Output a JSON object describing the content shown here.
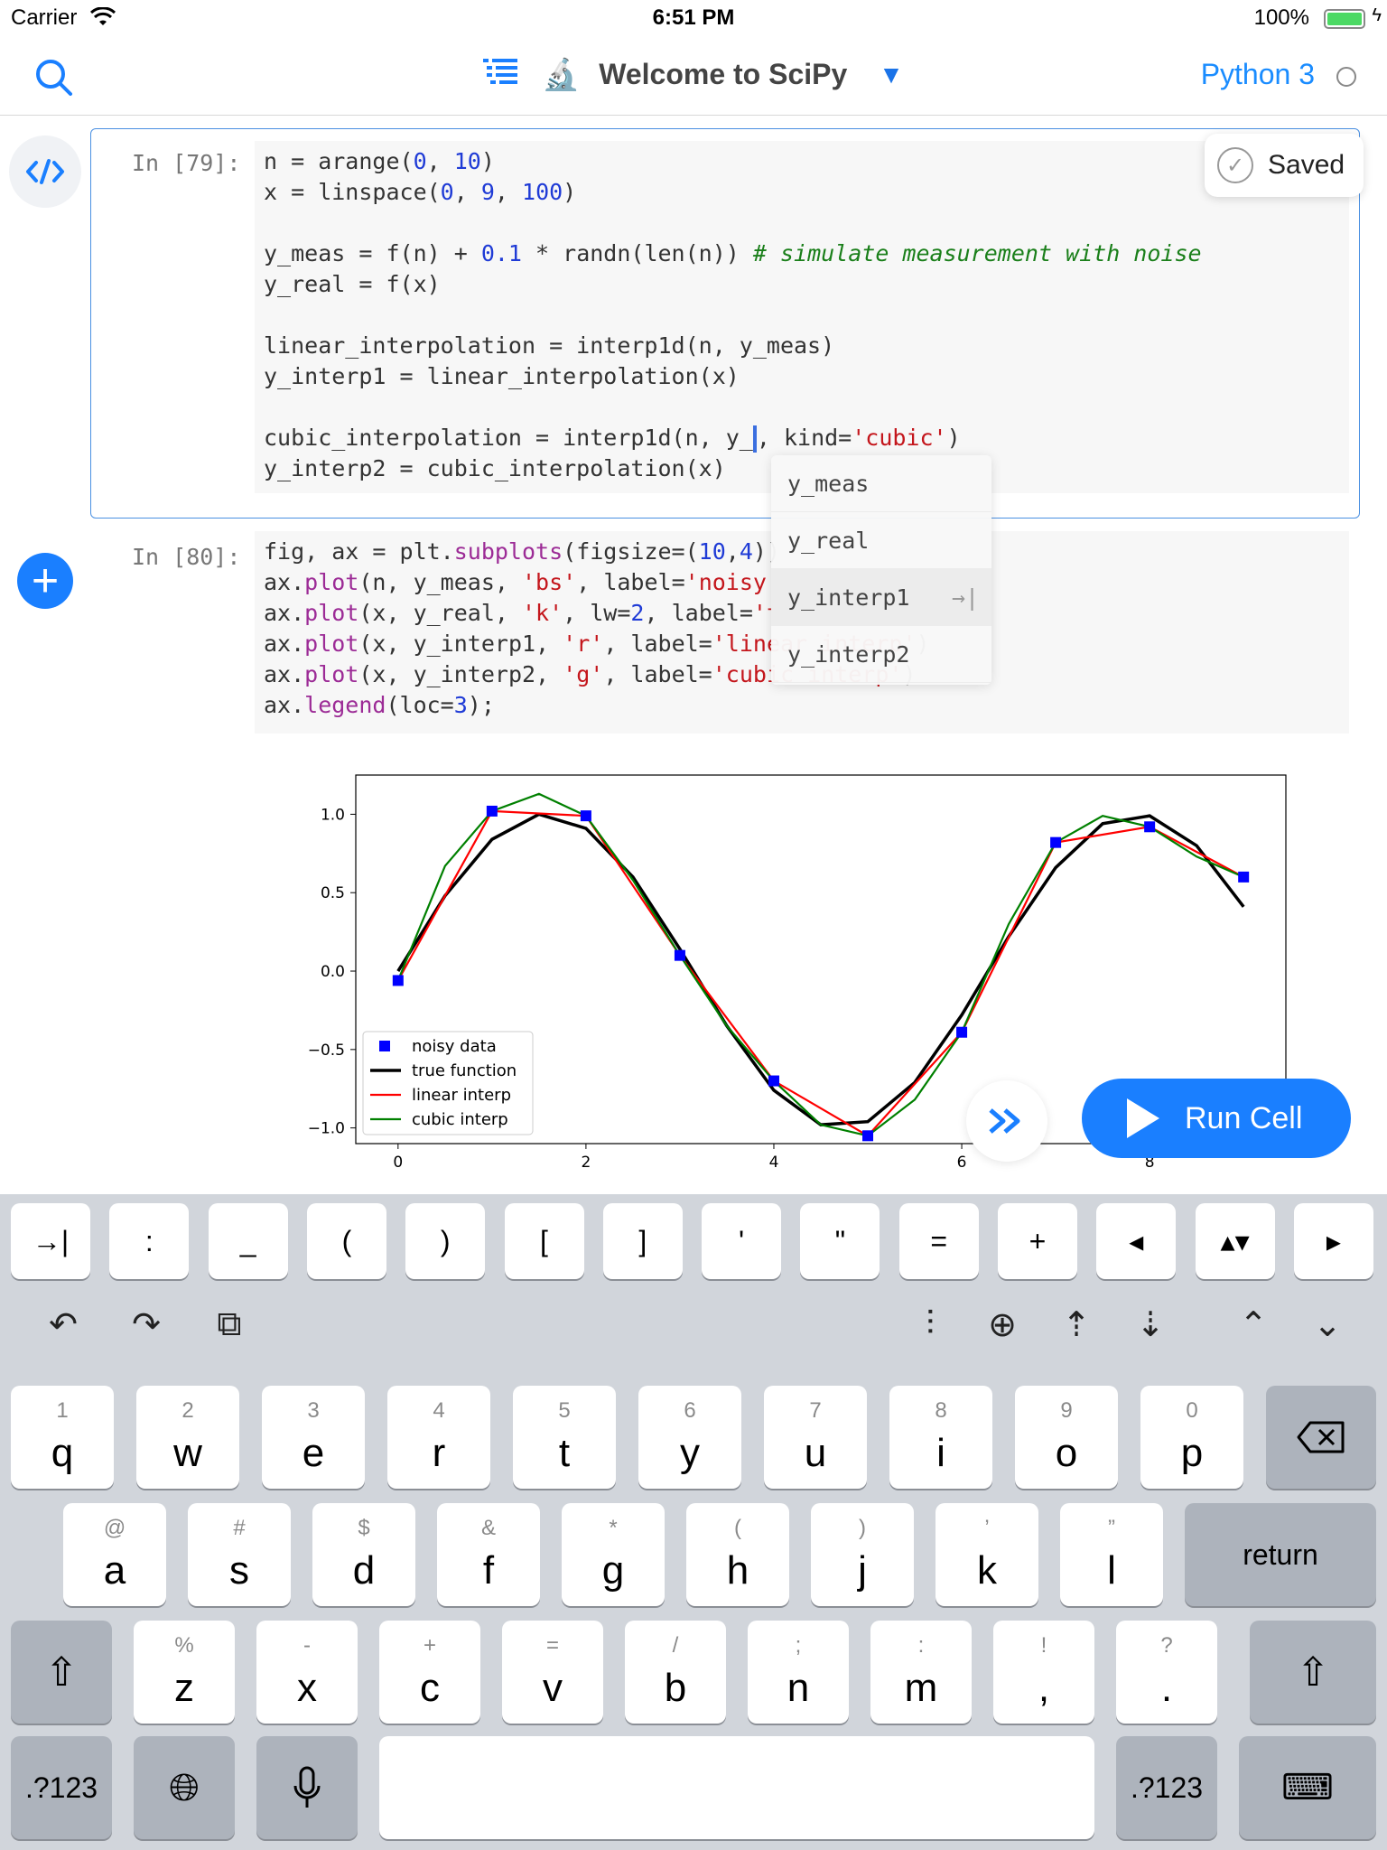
{
  "status_bar": {
    "carrier": "Carrier",
    "time": "6:51 PM",
    "battery": "100%"
  },
  "navbar": {
    "title": "Welcome to SciPy",
    "kernel": "Python 3",
    "icons": [
      "search-icon",
      "toc-icon",
      "microscope-icon",
      "dropdown-triangle-icon",
      "kernel-status-icon"
    ]
  },
  "cell1": {
    "prompt": "In [79]:",
    "lines": [
      "n = arange(0, 10)",
      "x = linspace(0, 9, 100)",
      "",
      "y_meas = f(n) + 0.1 * randn(len(n)) # simulate measurement with noise",
      "y_real = f(x)",
      "",
      "linear_interpolation = interp1d(n, y_meas)",
      "y_interp1 = linear_interpolation(x)",
      "",
      "cubic_interpolation = interp1d(n, y_, kind='cubic')",
      "y_interp2 = cubic_interpolation(x)"
    ]
  },
  "saved_badge": "Saved",
  "autocomplete": {
    "items": [
      "y_meas",
      "y_real",
      "y_interp1",
      "y_interp2"
    ],
    "selected_index": 2,
    "tab_hint": "→|"
  },
  "cell2": {
    "prompt": "In [80]:",
    "lines": [
      "fig, ax = plt.subplots(figsize=(10,4))",
      "ax.plot(n, y_meas, 'bs', label='noisy data')",
      "ax.plot(x, y_real, 'k', lw=2, label='true function')",
      "ax.plot(x, y_interp1, 'r', label='linear interp')",
      "ax.plot(x, y_interp2, 'g', label='cubic interp')",
      "ax.legend(loc=3);"
    ]
  },
  "chart_data": {
    "type": "line",
    "title": "",
    "xlabel": "",
    "ylabel": "",
    "xlim": [
      -0.45,
      9.45
    ],
    "ylim": [
      -1.1,
      1.25
    ],
    "xticks": [
      "0",
      "2",
      "4",
      "6",
      "8"
    ],
    "yticks": [
      "1.0",
      "0.5",
      "0.0",
      "−0.5",
      "−1.0"
    ],
    "legend_position": "lower-left",
    "grid": false,
    "series": [
      {
        "name": "noisy data",
        "kind": "scatter",
        "color": "#0000ff",
        "x": [
          0,
          1,
          2,
          3,
          4,
          5,
          6,
          7,
          8,
          9
        ],
        "y": [
          -0.06,
          1.02,
          0.99,
          0.1,
          -0.7,
          -1.05,
          -0.39,
          0.82,
          0.92,
          0.6
        ]
      },
      {
        "name": "true function",
        "kind": "line",
        "color": "#000000",
        "x": [
          0,
          0.5,
          1,
          1.5,
          2,
          2.5,
          3,
          3.5,
          4,
          4.5,
          5,
          5.5,
          6,
          6.5,
          7,
          7.5,
          8,
          8.5,
          9
        ],
        "y": [
          0,
          0.48,
          0.84,
          1.0,
          0.91,
          0.6,
          0.14,
          -0.35,
          -0.76,
          -0.98,
          -0.96,
          -0.71,
          -0.28,
          0.22,
          0.66,
          0.94,
          0.99,
          0.8,
          0.41
        ]
      },
      {
        "name": "linear interp",
        "kind": "line",
        "color": "#ff0000",
        "x": [
          0,
          1,
          2,
          3,
          4,
          5,
          6,
          7,
          8,
          9
        ],
        "y": [
          -0.06,
          1.02,
          0.99,
          0.1,
          -0.7,
          -1.05,
          -0.39,
          0.82,
          0.92,
          0.6
        ]
      },
      {
        "name": "cubic interp",
        "kind": "line",
        "color": "#008000",
        "x": [
          0,
          0.5,
          1,
          1.5,
          2,
          2.5,
          3,
          3.5,
          4,
          4.5,
          5,
          5.5,
          6,
          6.5,
          7,
          7.5,
          8,
          8.5,
          9
        ],
        "y": [
          -0.06,
          0.67,
          1.02,
          1.13,
          0.99,
          0.58,
          0.1,
          -0.35,
          -0.7,
          -0.98,
          -1.05,
          -0.82,
          -0.39,
          0.3,
          0.82,
          0.99,
          0.92,
          0.73,
          0.6
        ]
      }
    ]
  },
  "run_bar": {
    "run_label": "Run Cell",
    "icons": [
      "fast-forward-icon",
      "play-icon"
    ]
  },
  "keyboard": {
    "symbol_row": [
      "→|",
      ":",
      "_",
      "(",
      ")",
      "[",
      "]",
      "'",
      "\"",
      "=",
      "+",
      "◂",
      "▴▾",
      "▸"
    ],
    "toolbar_icons": [
      "undo-icon",
      "redo-icon",
      "paste-icon",
      "split-cell-icon",
      "add-cell-icon",
      "move-cell-up-icon",
      "move-cell-down-icon",
      "select-above-icon",
      "select-below-icon"
    ],
    "row1": [
      [
        "1",
        "q"
      ],
      [
        "2",
        "w"
      ],
      [
        "3",
        "e"
      ],
      [
        "4",
        "r"
      ],
      [
        "5",
        "t"
      ],
      [
        "6",
        "y"
      ],
      [
        "7",
        "u"
      ],
      [
        "8",
        "i"
      ],
      [
        "9",
        "o"
      ],
      [
        "0",
        "p"
      ]
    ],
    "row2": [
      [
        "@",
        "a"
      ],
      [
        "#",
        "s"
      ],
      [
        "$",
        "d"
      ],
      [
        "&",
        "f"
      ],
      [
        "*",
        "g"
      ],
      [
        "(",
        "h"
      ],
      [
        ")",
        "j"
      ],
      [
        "’",
        "k"
      ],
      [
        "”",
        "l"
      ]
    ],
    "row3": [
      [
        "%",
        "z"
      ],
      [
        "-",
        "x"
      ],
      [
        "+",
        "c"
      ],
      [
        "=",
        "v"
      ],
      [
        "/",
        "b"
      ],
      [
        ";",
        "n"
      ],
      [
        ":",
        "m"
      ],
      [
        "!",
        ","
      ],
      [
        "?",
        "."
      ]
    ],
    "return_label": "return",
    "numbers_label": ".?123"
  }
}
